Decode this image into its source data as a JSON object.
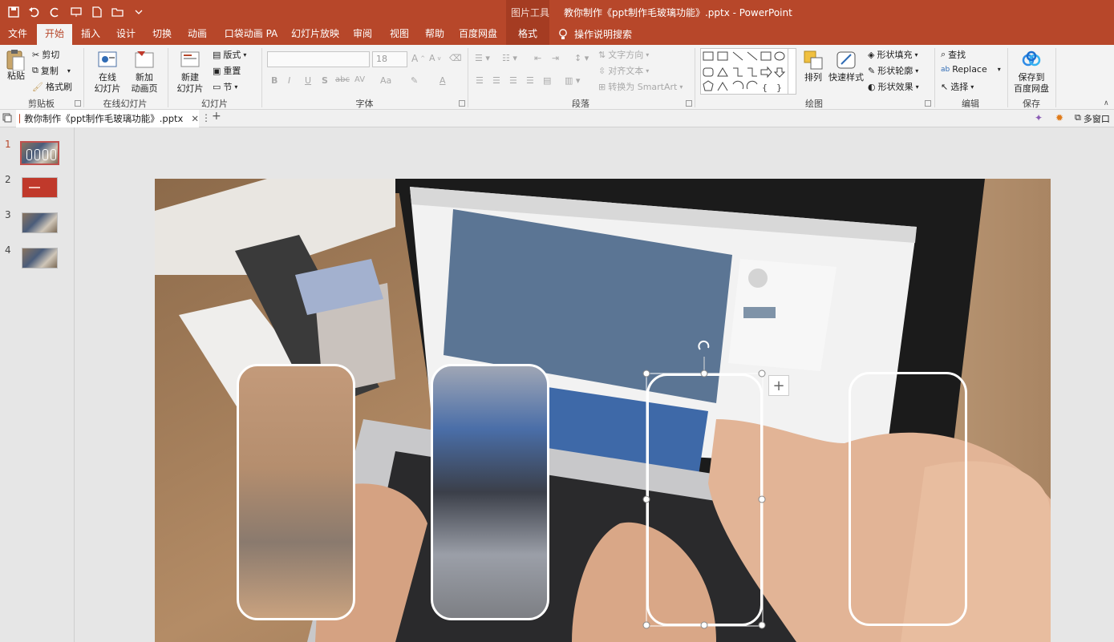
{
  "window": {
    "context_tool": "图片工具",
    "title": "教你制作《ppt制作毛玻璃功能》.pptx  -  PowerPoint"
  },
  "tabs": [
    "文件",
    "开始",
    "插入",
    "设计",
    "切换",
    "动画",
    "口袋动画 PA",
    "幻灯片放映",
    "审阅",
    "视图",
    "帮助",
    "百度网盘",
    "格式"
  ],
  "tell_me": "操作说明搜索",
  "ribbon": {
    "clipboard": {
      "paste": "粘贴",
      "cut": "剪切",
      "copy": "复制",
      "painter": "格式刷",
      "label": "剪贴板"
    },
    "online": {
      "online_slide_1": "在线",
      "online_slide_2": "幻灯片",
      "new_anim_1": "新加",
      "new_anim_2": "动画页",
      "label": "在线幻灯片"
    },
    "slides": {
      "new_slide_1": "新建",
      "new_slide_2": "幻灯片",
      "layout": "版式",
      "reset": "重置",
      "section": "节",
      "label": "幻灯片"
    },
    "font": {
      "size": "18",
      "bold": "B",
      "italic": "I",
      "underline": "U",
      "shadow": "S",
      "strike": "abc",
      "spacing": "AV",
      "case": "Aa",
      "color": "A",
      "label": "字体"
    },
    "paragraph": {
      "text_direction": "文字方向",
      "align_text": "对齐文本",
      "smartart": "转换为 SmartArt",
      "label": "段落"
    },
    "drawing": {
      "arrange": "排列",
      "quick_styles": "快速样式",
      "fill": "形状填充",
      "outline": "形状轮廓",
      "effect": "形状效果",
      "label": "绘图"
    },
    "editing": {
      "find": "查找",
      "replace": "Replace",
      "select": "选择",
      "label": "编辑"
    },
    "save": {
      "save_1": "保存到",
      "save_2": "百度网盘",
      "label": "保存"
    }
  },
  "doc_tab": {
    "name": "教你制作《ppt制作毛玻璃功能》.pptx",
    "right_label": "多窗口"
  },
  "slides": [
    {
      "num": "1"
    },
    {
      "num": "2"
    },
    {
      "num": "3"
    },
    {
      "num": "4"
    }
  ],
  "colors": {
    "accent": "#b7472a",
    "ribbon": "#f3f3f3"
  }
}
